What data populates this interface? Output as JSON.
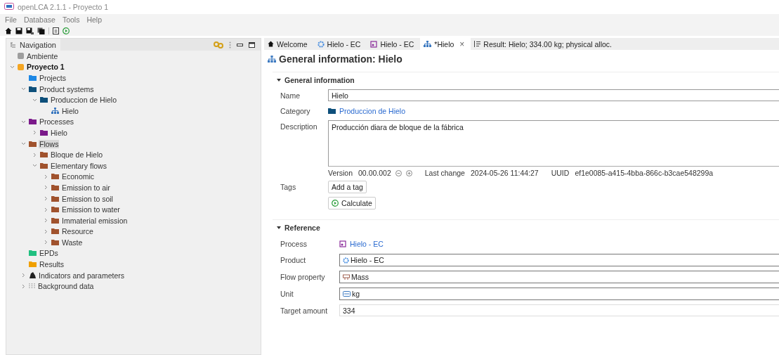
{
  "window": {
    "title": "openLCA 2.1.1 - Proyecto 1"
  },
  "menu": [
    "File",
    "Database",
    "Tools",
    "Help"
  ],
  "navigation": {
    "title": "Navigation",
    "tree": [
      {
        "label": "Ambiente",
        "kind": "database",
        "color": "#9e9e9e",
        "active": false,
        "selected": false
      },
      {
        "label": "Proyecto 1",
        "kind": "database",
        "color": "#f5a623",
        "active": true,
        "selected": false,
        "expanded": true,
        "children": [
          {
            "label": "Projects",
            "kind": "folder",
            "color": "#1e88e5",
            "selected": false
          },
          {
            "label": "Product systems",
            "kind": "folder",
            "color": "#0d4f7a",
            "selected": false,
            "expanded": true,
            "children": [
              {
                "label": "Produccion de Hielo",
                "kind": "folder",
                "color": "#0d4f7a",
                "selected": false,
                "expanded": true,
                "children": [
                  {
                    "label": "Hielo",
                    "kind": "system",
                    "selected": false
                  }
                ]
              }
            ]
          },
          {
            "label": "Processes",
            "kind": "folder",
            "color": "#7b1a8a",
            "selected": false,
            "expanded": true,
            "children": [
              {
                "label": "Hielo",
                "kind": "folder",
                "color": "#7b1a8a",
                "selected": false,
                "expanded": false
              }
            ]
          },
          {
            "label": "Flows",
            "kind": "folder",
            "color": "#a0522d",
            "selected": true,
            "expanded": true,
            "children": [
              {
                "label": "Bloque de Hielo",
                "kind": "folder",
                "color": "#a0522d",
                "selected": false,
                "expanded": false
              },
              {
                "label": "Elementary flows",
                "kind": "folder",
                "color": "#a0522d",
                "selected": false,
                "expanded": true,
                "children": [
                  {
                    "label": "Economic",
                    "kind": "folder",
                    "color": "#a0522d",
                    "selected": false,
                    "expanded": false
                  },
                  {
                    "label": "Emission to air",
                    "kind": "folder",
                    "color": "#a0522d",
                    "selected": false,
                    "expanded": false
                  },
                  {
                    "label": "Emission to soil",
                    "kind": "folder",
                    "color": "#a0522d",
                    "selected": false,
                    "expanded": false
                  },
                  {
                    "label": "Emission to water",
                    "kind": "folder",
                    "color": "#a0522d",
                    "selected": false,
                    "expanded": false
                  },
                  {
                    "label": "Immaterial emission",
                    "kind": "folder",
                    "color": "#a0522d",
                    "selected": false,
                    "expanded": false
                  },
                  {
                    "label": "Resource",
                    "kind": "folder",
                    "color": "#a0522d",
                    "selected": false,
                    "expanded": false
                  },
                  {
                    "label": "Waste",
                    "kind": "folder",
                    "color": "#a0522d",
                    "selected": false,
                    "expanded": false
                  }
                ]
              }
            ]
          },
          {
            "label": "EPDs",
            "kind": "folder",
            "color": "#20c080",
            "selected": false
          },
          {
            "label": "Results",
            "kind": "folder",
            "color": "#f0a000",
            "selected": false
          },
          {
            "label": "Indicators and parameters",
            "kind": "indicators",
            "selected": false,
            "expanded": false
          },
          {
            "label": "Background data",
            "kind": "background",
            "selected": false,
            "expanded": false
          }
        ]
      }
    ]
  },
  "tabs": [
    {
      "label": "Welcome",
      "kind": "home",
      "selected": false
    },
    {
      "label": "Hielo - EC",
      "kind": "flow",
      "selected": false
    },
    {
      "label": "Hielo - EC",
      "kind": "process",
      "selected": false
    },
    {
      "label": "*Hielo",
      "kind": "system",
      "selected": true,
      "close": "×"
    },
    {
      "label": "Result: Hielo; 334.00 kg; physical alloc.",
      "kind": "result",
      "selected": false
    }
  ],
  "editor": {
    "title": "General information: Hielo",
    "general": {
      "title": "General information",
      "name_label": "Name",
      "name": "Hielo",
      "category_label": "Category",
      "category": "Produccion de Hielo",
      "description_label": "Description",
      "description": "Producción diara de bloque de la fábrica",
      "version_label": "Version",
      "version": "00.00.002",
      "last_change_label": "Last change",
      "last_change": "2024-05-26 11:44:27",
      "uuid_label": "UUID",
      "uuid": "ef1e0085-a415-4bba-866c-b3cae548299a",
      "tags_label": "Tags",
      "add_tag": "Add a tag",
      "calculate": "Calculate"
    },
    "reference": {
      "title": "Reference",
      "fields": [
        {
          "label": "Process",
          "value": "Hielo - EC",
          "kind": "process"
        },
        {
          "label": "Product",
          "value": "Hielo - EC",
          "kind": "flow"
        },
        {
          "label": "Flow property",
          "value": "Mass",
          "kind": "property"
        },
        {
          "label": "Unit",
          "value": "kg",
          "kind": "unit"
        },
        {
          "label": "Target amount",
          "value": "334",
          "kind": "amount"
        }
      ]
    }
  }
}
